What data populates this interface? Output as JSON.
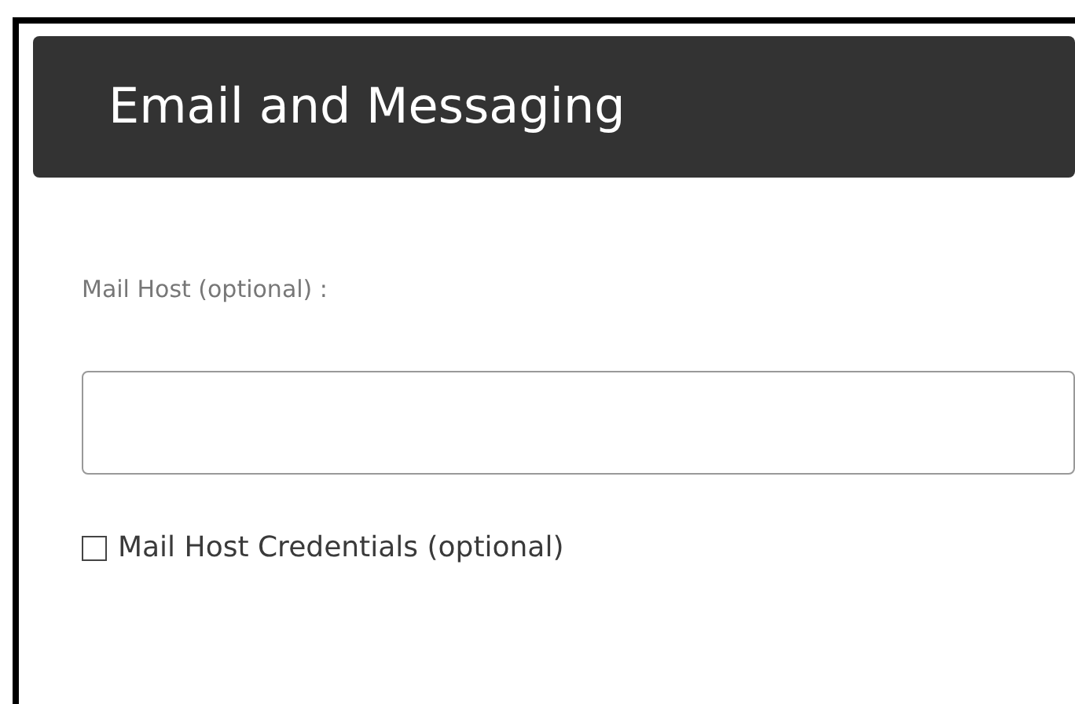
{
  "header": {
    "title": "Email and Messaging"
  },
  "mail_host": {
    "label": "Mail Host (optional) :"
  },
  "credentials": {
    "label": "Mail Host Credentials (optional)",
    "checked": false
  }
}
